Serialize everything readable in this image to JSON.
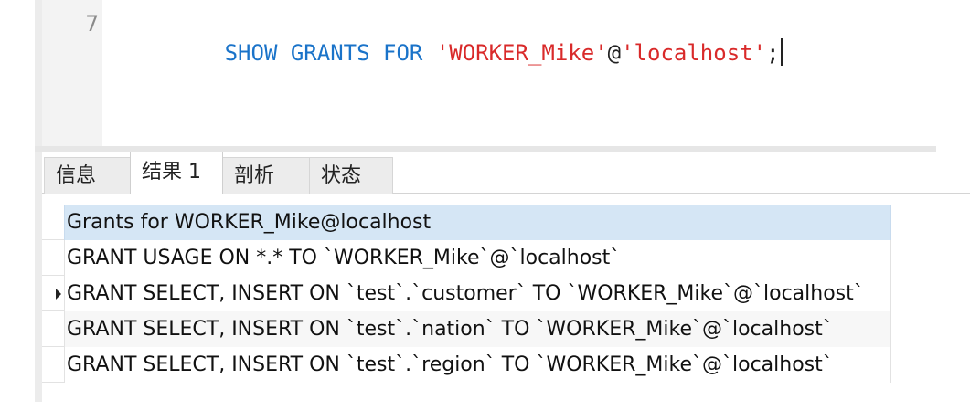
{
  "editor": {
    "line_number": "7",
    "tokens": [
      {
        "text": "SHOW",
        "kind": "kw"
      },
      {
        "text": " ",
        "kind": "punc"
      },
      {
        "text": "GRANTS",
        "kind": "kw"
      },
      {
        "text": " ",
        "kind": "punc"
      },
      {
        "text": "FOR",
        "kind": "kw"
      },
      {
        "text": " ",
        "kind": "punc"
      },
      {
        "text": "'WORKER_Mike'",
        "kind": "str"
      },
      {
        "text": "@",
        "kind": "punc"
      },
      {
        "text": "'localhost'",
        "kind": "str"
      },
      {
        "text": ";",
        "kind": "punc"
      }
    ]
  },
  "tabs": [
    {
      "label": "信息",
      "active": false
    },
    {
      "label": "结果 1",
      "active": true
    },
    {
      "label": "剖析",
      "active": false
    },
    {
      "label": "状态",
      "active": false
    }
  ],
  "result": {
    "column_header": "Grants for WORKER_Mike@localhost",
    "rows": [
      "GRANT USAGE ON *.* TO `WORKER_Mike`@`localhost`",
      "GRANT SELECT, INSERT ON `test`.`customer` TO `WORKER_Mike`@`localhost`",
      "GRANT SELECT, INSERT ON `test`.`nation` TO `WORKER_Mike`@`localhost`",
      "GRANT SELECT, INSERT ON `test`.`region` TO `WORKER_Mike`@`localhost`"
    ],
    "current_row_index": 1
  },
  "colors": {
    "keyword": "#1a73c9",
    "string": "#d92a2a",
    "header_bg": "#d5e6f5"
  }
}
